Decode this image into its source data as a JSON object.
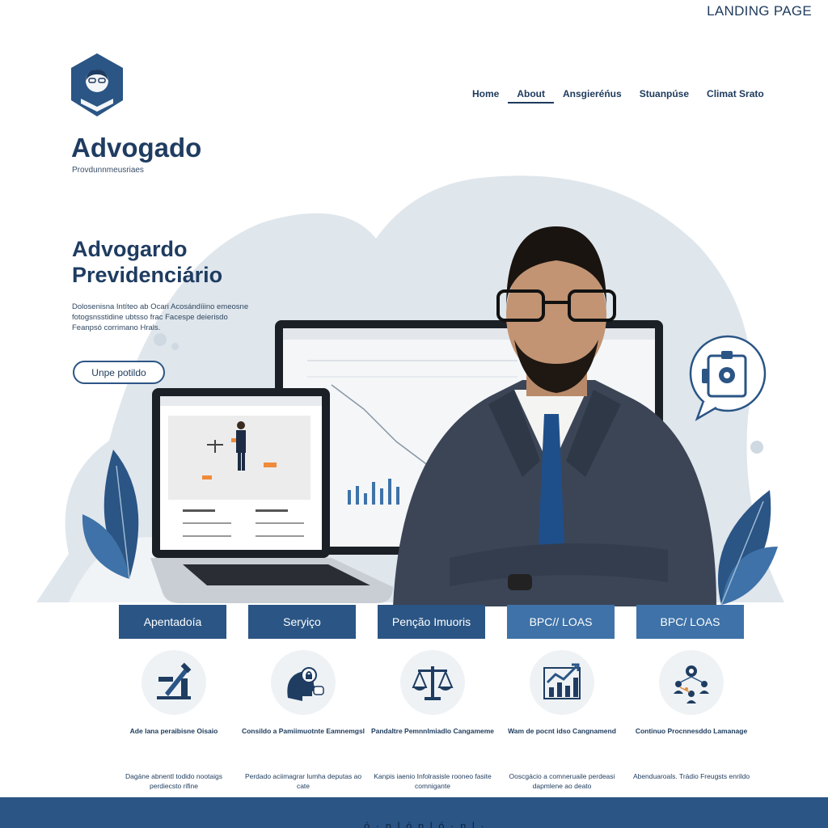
{
  "header": {
    "label": "LANDING PAGE",
    "brand_name": "Advogado",
    "brand_sub": "Provdunnmeusriaes",
    "nav": [
      {
        "label": "Home"
      },
      {
        "label": "About"
      },
      {
        "label": "Ansgieréńus"
      },
      {
        "label": "Stuanpúse"
      },
      {
        "label": "Climat Srato"
      }
    ]
  },
  "hero": {
    "title_line1": "Advogardo",
    "title_line2": "Previdenciário",
    "text": "Dolosenisna Intíteo ab Ocari Acosándíiino emeosne fotogsnsstidine ubtsso frac Facespe deierisdo Feanpsó corrimano Hrals.",
    "cta": "Unpe potildo"
  },
  "services": [
    {
      "label": "Apentadoía",
      "color": "#2a5585"
    },
    {
      "label": "Seryiço",
      "color": "#2a5585"
    },
    {
      "label": "Penção Imuoris",
      "color": "#2a5585"
    },
    {
      "label": "BPC// LOAS",
      "color": "#3e72a8"
    },
    {
      "label": "BPC/ LOAS",
      "color": "#3e72a8"
    }
  ],
  "features": [
    {
      "icon": "gavel-building-icon",
      "caption": "Ade lana peraibisne Oisaio",
      "desc": "Dagáne abnentl todido nootaigs perdiecsto rifine"
    },
    {
      "icon": "head-lock-icon",
      "caption": "Consildo a Pamiimuotnte Eamnemgsl",
      "desc": "Perdado aciimagrar lumha deputas ao cate"
    },
    {
      "icon": "scales-icon",
      "caption": "Pandaltre Pemnnlmiadlo Cangameme",
      "desc": "Kanpis iaenio Infolrasisle rooneo fasite comnigante"
    },
    {
      "icon": "growth-chart-icon",
      "caption": "Wam de pocnt idso Cangnamend",
      "desc": "Ooscgácio a comneruaile perdeasi dapmlene ao deato"
    },
    {
      "icon": "network-people-icon",
      "caption": "Continuo Procnnesddo Lamanage",
      "desc": "Abenduaroals. Trádio Freugsts enrildo"
    }
  ],
  "footer": {
    "text": "ó · n l ó n l ó · n l ·"
  },
  "colors": {
    "primary": "#1f3c61",
    "tab_dark": "#2a5585",
    "tab_light": "#3e72a8",
    "blob": "#dfe6ec"
  }
}
